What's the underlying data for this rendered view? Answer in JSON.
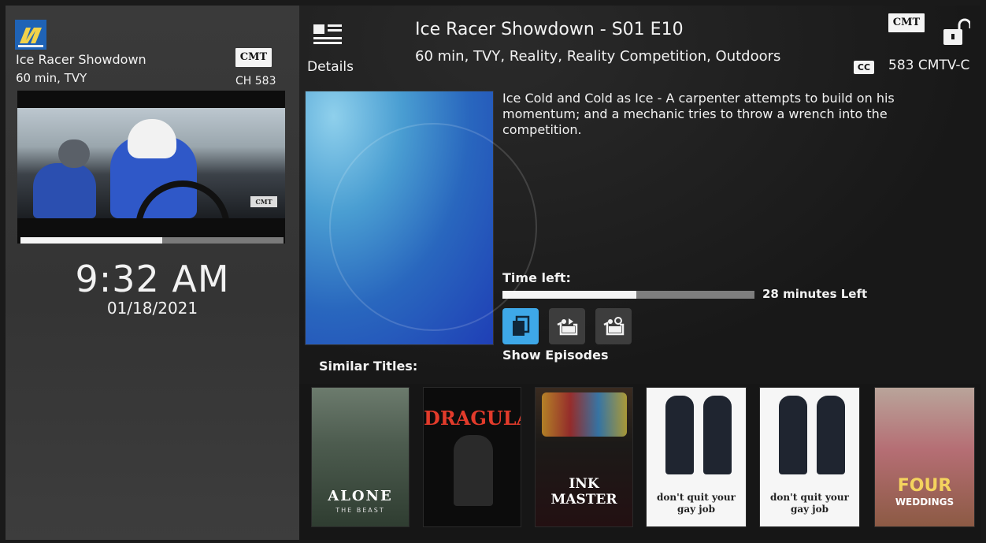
{
  "left_panel": {
    "program_title": "Ice Racer Showdown",
    "program_meta": "60 min, TVY",
    "network_badge": "CMT",
    "channel": "CH 583",
    "video_progress": 0.54,
    "video_bug": "CMT",
    "clock": "9:32 AM",
    "date": "01/18/2021"
  },
  "header": {
    "details_label": "Details",
    "episode_title": "Ice Racer Showdown - S01 E10",
    "episode_meta": "60 min, TVY, Reality, Reality Competition, Outdoors",
    "network_badge": "CMT",
    "cc_label": "CC",
    "channel": "583 CMTV-C"
  },
  "description": "Ice Cold and Cold as Ice - A carpenter attempts to build on his momentum; and a mechanic tries to throw a wrench into the competition.",
  "time_left": {
    "label": "Time left:",
    "progress": 0.53,
    "text": "28 minutes Left"
  },
  "actions": {
    "focused_label": "Show Episodes"
  },
  "similar": {
    "label": "Similar Titles:",
    "titles": [
      {
        "title": "ALONE",
        "subtitle": "THE BEAST"
      },
      {
        "title": "DRAGULA"
      },
      {
        "title": "INK MASTER"
      },
      {
        "title": "don't quit your gay job"
      },
      {
        "title": "don't quit your gay job"
      },
      {
        "title": "FOUR",
        "subtitle": "WEDDINGS"
      }
    ]
  },
  "colors": {
    "accent": "#3ea8e8",
    "background": "#161616",
    "left_panel": "#3a3a3a"
  },
  "icons": [
    "logo-icon",
    "details-icon",
    "lock-icon",
    "cc-icon",
    "episodes-icon",
    "record-icon",
    "record-series-icon"
  ]
}
